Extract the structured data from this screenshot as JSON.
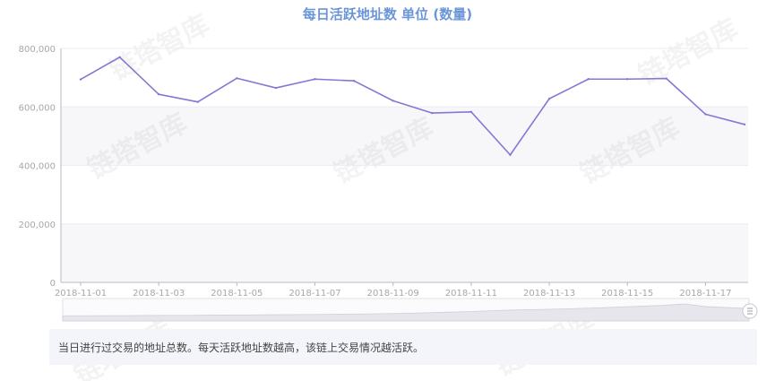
{
  "colors": {
    "title": "#6a95d8",
    "line": "#8478d4",
    "band": "#f7f7fa",
    "axis": "#b9b9c4",
    "note_bg": "#f4f4fb"
  },
  "watermark": {
    "text": "链塔智库"
  },
  "slider": {
    "handle_icon": "slider-handle-icon"
  },
  "note": {
    "text": "当日进行过交易的地址总数。每天活跃地址数越高，该链上交易情况越活跃。"
  },
  "chart_data": {
    "type": "line",
    "title": "每日活跃地址数 单位 (数量)",
    "xlabel": "",
    "ylabel": "",
    "x": [
      "2018-11-01",
      "2018-11-02",
      "2018-11-03",
      "2018-11-04",
      "2018-11-05",
      "2018-11-06",
      "2018-11-07",
      "2018-11-08",
      "2018-11-09",
      "2018-11-10",
      "2018-11-11",
      "2018-11-12",
      "2018-11-13",
      "2018-11-14",
      "2018-11-15",
      "2018-11-16",
      "2018-11-17",
      "2018-11-18"
    ],
    "x_tick_labels": [
      "2018-11-01",
      "2018-11-03",
      "2018-11-05",
      "2018-11-07",
      "2018-11-09",
      "2018-11-11",
      "2018-11-13",
      "2018-11-15",
      "2018-11-17"
    ],
    "y_tick_labels": [
      "0",
      "200,000",
      "400,000",
      "600,000",
      "800,000"
    ],
    "ylim": [
      0,
      800000
    ],
    "grid": true,
    "legend": "none",
    "series": [
      {
        "values": [
          694000,
          770000,
          643000,
          617000,
          698000,
          665000,
          695000,
          689000,
          621000,
          579000,
          583000,
          436000,
          628000,
          695000,
          695000,
          697000,
          575000,
          540000
        ]
      }
    ],
    "minimap_values": [
      0.22,
      0.22,
      0.23,
      0.23,
      0.24,
      0.25,
      0.25,
      0.26,
      0.27,
      0.28,
      0.29,
      0.3,
      0.31,
      0.33,
      0.34,
      0.36,
      0.38,
      0.42,
      0.46,
      0.5,
      0.55,
      0.6,
      0.62,
      0.66,
      0.7,
      0.74,
      0.8,
      0.85,
      0.9,
      1.0,
      0.82,
      0.76,
      0.7
    ]
  }
}
